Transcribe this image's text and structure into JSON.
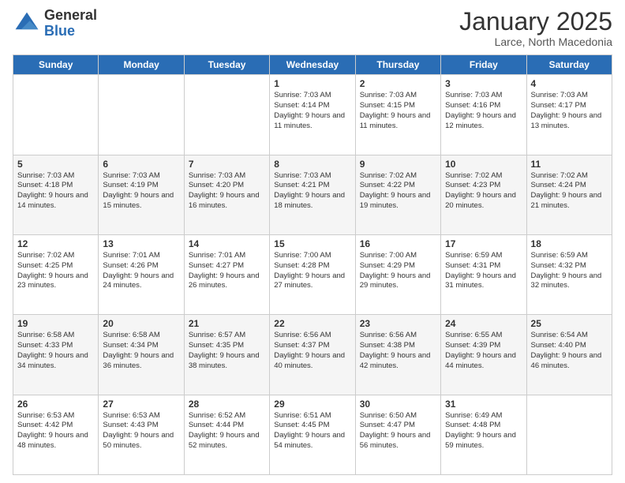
{
  "header": {
    "logo_general": "General",
    "logo_blue": "Blue",
    "month_title": "January 2025",
    "location": "Larce, North Macedonia"
  },
  "weekdays": [
    "Sunday",
    "Monday",
    "Tuesday",
    "Wednesday",
    "Thursday",
    "Friday",
    "Saturday"
  ],
  "weeks": [
    [
      {
        "day": null
      },
      {
        "day": null
      },
      {
        "day": null
      },
      {
        "day": "1",
        "sunrise": "7:03 AM",
        "sunset": "4:14 PM",
        "daylight": "9 hours and 11 minutes."
      },
      {
        "day": "2",
        "sunrise": "7:03 AM",
        "sunset": "4:15 PM",
        "daylight": "9 hours and 11 minutes."
      },
      {
        "day": "3",
        "sunrise": "7:03 AM",
        "sunset": "4:16 PM",
        "daylight": "9 hours and 12 minutes."
      },
      {
        "day": "4",
        "sunrise": "7:03 AM",
        "sunset": "4:17 PM",
        "daylight": "9 hours and 13 minutes."
      }
    ],
    [
      {
        "day": "5",
        "sunrise": "7:03 AM",
        "sunset": "4:18 PM",
        "daylight": "9 hours and 14 minutes."
      },
      {
        "day": "6",
        "sunrise": "7:03 AM",
        "sunset": "4:19 PM",
        "daylight": "9 hours and 15 minutes."
      },
      {
        "day": "7",
        "sunrise": "7:03 AM",
        "sunset": "4:20 PM",
        "daylight": "9 hours and 16 minutes."
      },
      {
        "day": "8",
        "sunrise": "7:03 AM",
        "sunset": "4:21 PM",
        "daylight": "9 hours and 18 minutes."
      },
      {
        "day": "9",
        "sunrise": "7:02 AM",
        "sunset": "4:22 PM",
        "daylight": "9 hours and 19 minutes."
      },
      {
        "day": "10",
        "sunrise": "7:02 AM",
        "sunset": "4:23 PM",
        "daylight": "9 hours and 20 minutes."
      },
      {
        "day": "11",
        "sunrise": "7:02 AM",
        "sunset": "4:24 PM",
        "daylight": "9 hours and 21 minutes."
      }
    ],
    [
      {
        "day": "12",
        "sunrise": "7:02 AM",
        "sunset": "4:25 PM",
        "daylight": "9 hours and 23 minutes."
      },
      {
        "day": "13",
        "sunrise": "7:01 AM",
        "sunset": "4:26 PM",
        "daylight": "9 hours and 24 minutes."
      },
      {
        "day": "14",
        "sunrise": "7:01 AM",
        "sunset": "4:27 PM",
        "daylight": "9 hours and 26 minutes."
      },
      {
        "day": "15",
        "sunrise": "7:00 AM",
        "sunset": "4:28 PM",
        "daylight": "9 hours and 27 minutes."
      },
      {
        "day": "16",
        "sunrise": "7:00 AM",
        "sunset": "4:29 PM",
        "daylight": "9 hours and 29 minutes."
      },
      {
        "day": "17",
        "sunrise": "6:59 AM",
        "sunset": "4:31 PM",
        "daylight": "9 hours and 31 minutes."
      },
      {
        "day": "18",
        "sunrise": "6:59 AM",
        "sunset": "4:32 PM",
        "daylight": "9 hours and 32 minutes."
      }
    ],
    [
      {
        "day": "19",
        "sunrise": "6:58 AM",
        "sunset": "4:33 PM",
        "daylight": "9 hours and 34 minutes."
      },
      {
        "day": "20",
        "sunrise": "6:58 AM",
        "sunset": "4:34 PM",
        "daylight": "9 hours and 36 minutes."
      },
      {
        "day": "21",
        "sunrise": "6:57 AM",
        "sunset": "4:35 PM",
        "daylight": "9 hours and 38 minutes."
      },
      {
        "day": "22",
        "sunrise": "6:56 AM",
        "sunset": "4:37 PM",
        "daylight": "9 hours and 40 minutes."
      },
      {
        "day": "23",
        "sunrise": "6:56 AM",
        "sunset": "4:38 PM",
        "daylight": "9 hours and 42 minutes."
      },
      {
        "day": "24",
        "sunrise": "6:55 AM",
        "sunset": "4:39 PM",
        "daylight": "9 hours and 44 minutes."
      },
      {
        "day": "25",
        "sunrise": "6:54 AM",
        "sunset": "4:40 PM",
        "daylight": "9 hours and 46 minutes."
      }
    ],
    [
      {
        "day": "26",
        "sunrise": "6:53 AM",
        "sunset": "4:42 PM",
        "daylight": "9 hours and 48 minutes."
      },
      {
        "day": "27",
        "sunrise": "6:53 AM",
        "sunset": "4:43 PM",
        "daylight": "9 hours and 50 minutes."
      },
      {
        "day": "28",
        "sunrise": "6:52 AM",
        "sunset": "4:44 PM",
        "daylight": "9 hours and 52 minutes."
      },
      {
        "day": "29",
        "sunrise": "6:51 AM",
        "sunset": "4:45 PM",
        "daylight": "9 hours and 54 minutes."
      },
      {
        "day": "30",
        "sunrise": "6:50 AM",
        "sunset": "4:47 PM",
        "daylight": "9 hours and 56 minutes."
      },
      {
        "day": "31",
        "sunrise": "6:49 AM",
        "sunset": "4:48 PM",
        "daylight": "9 hours and 59 minutes."
      },
      {
        "day": null
      }
    ]
  ]
}
